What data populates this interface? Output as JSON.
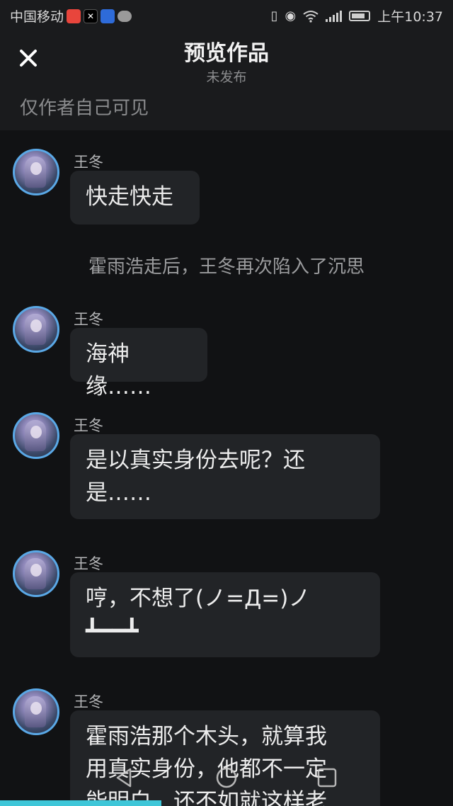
{
  "status_bar": {
    "carrier": "中国移动",
    "app_icons": [
      "red-app-icon",
      "capcut-icon",
      "baidu-icon",
      "chat-icon"
    ],
    "status_icons": [
      "vibrate-icon",
      "eye-icon",
      "wifi-icon",
      "signal-icon",
      "battery-icon"
    ],
    "time": "上午10:37"
  },
  "header": {
    "close_icon": "close-icon",
    "title": "预览作品",
    "subtitle": "未发布"
  },
  "visibility_note": "仅作者自己可见",
  "messages": [
    {
      "type": "chat",
      "name": "王冬",
      "lines": [
        "快走快走"
      ]
    },
    {
      "type": "narration",
      "text": "霍雨浩走后，王冬再次陷入了沉思"
    },
    {
      "type": "chat",
      "name": "王冬",
      "lines": [
        "海神缘……"
      ]
    },
    {
      "type": "chat",
      "name": "王冬",
      "lines": [
        "是以真实身份去呢？还",
        "是……"
      ]
    },
    {
      "type": "chat",
      "name": "王冬",
      "lines": [
        "哼，不想了(ノ=Д=)ノ",
        "┻━━┻"
      ]
    },
    {
      "type": "chat",
      "name": "王冬",
      "lines": [
        "霍雨浩那个木头，就算我",
        "用真实身份，他都不一定",
        "能明白，还不如就这样老"
      ]
    }
  ],
  "nav_icons": [
    "back-icon",
    "home-icon",
    "recents-icon"
  ],
  "colors": {
    "background": "#111214",
    "header_bg": "#1a1b1d",
    "bubble_bg": "#222427",
    "avatar_ring": "#5aa8e6",
    "progress": "#3ec6d8"
  }
}
